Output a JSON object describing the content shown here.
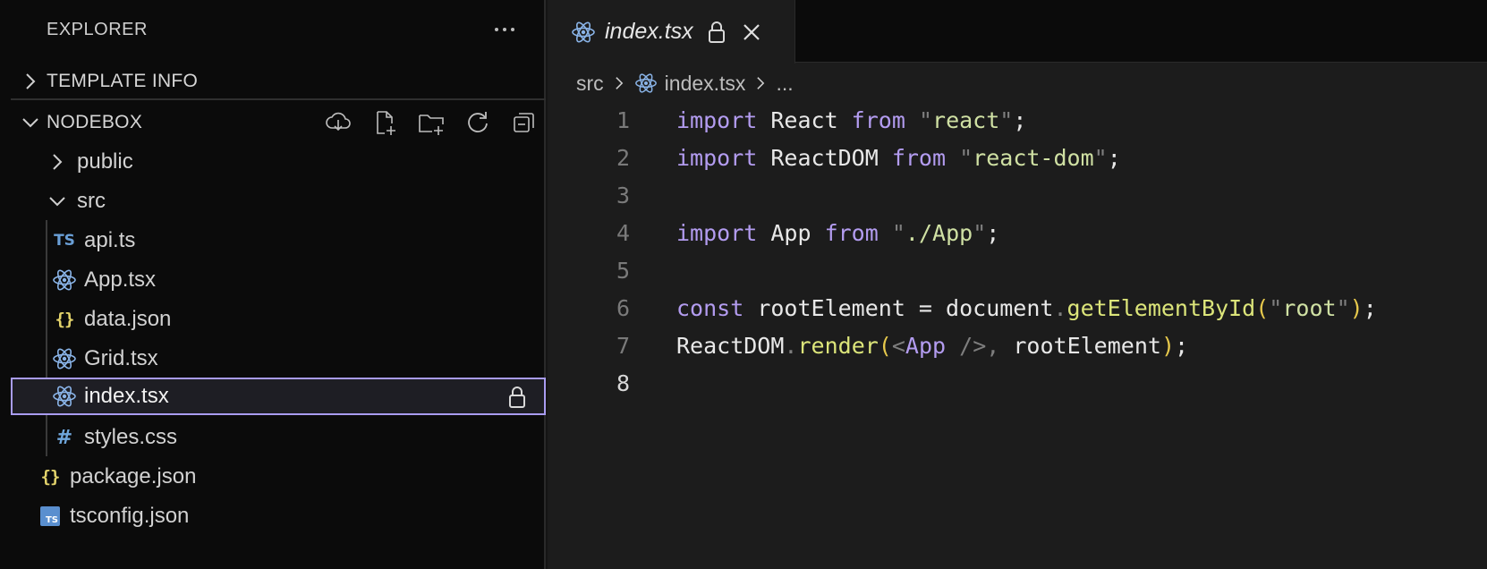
{
  "explorer": {
    "title": "EXPLORER",
    "sections": [
      {
        "label": "TEMPLATE INFO"
      },
      {
        "label": "NODEBOX"
      }
    ],
    "toolbar_icons": [
      "download-icon",
      "new-file-icon",
      "new-folder-icon",
      "refresh-icon",
      "collapse-all-icon"
    ],
    "tree": [
      {
        "label": "public",
        "type": "folder",
        "icon": "chevron-right-icon"
      },
      {
        "label": "src",
        "type": "folder",
        "icon": "chevron-down-icon"
      },
      {
        "label": "api.ts",
        "type": "file",
        "icon": "ts-icon",
        "glyph": "TS"
      },
      {
        "label": "App.tsx",
        "type": "file",
        "icon": "react-icon"
      },
      {
        "label": "data.json",
        "type": "file",
        "icon": "json-icon",
        "glyph": "{}"
      },
      {
        "label": "Grid.tsx",
        "type": "file",
        "icon": "react-icon"
      },
      {
        "label": "index.tsx",
        "type": "file",
        "icon": "react-icon",
        "selected": true,
        "locked": true
      },
      {
        "label": "styles.css",
        "type": "file",
        "icon": "css-icon",
        "glyph": "#"
      },
      {
        "label": "package.json",
        "type": "file",
        "icon": "json-icon",
        "glyph": "{}"
      },
      {
        "label": "tsconfig.json",
        "type": "file",
        "icon": "tsconfig-icon",
        "glyph": "TS"
      }
    ]
  },
  "editor": {
    "tab": {
      "label": "index.tsx"
    },
    "breadcrumb": [
      "src",
      "index.tsx",
      "..."
    ],
    "lines": [
      {
        "n": "1",
        "text": "import React from \"react\";"
      },
      {
        "n": "2",
        "text": "import ReactDOM from \"react-dom\";"
      },
      {
        "n": "3",
        "text": ""
      },
      {
        "n": "4",
        "text": "import App from \"./App\";"
      },
      {
        "n": "5",
        "text": ""
      },
      {
        "n": "6",
        "text": "const rootElement = document.getElementById(\"root\");"
      },
      {
        "n": "7",
        "text": "ReactDOM.render(<App />, rootElement);"
      },
      {
        "n": "8",
        "text": ""
      }
    ]
  },
  "colors": {
    "keyword": "#b39cf0",
    "string": "#cfe0a3",
    "function": "#dce57a",
    "selection_border": "#a99cf0",
    "react_icon": "#8ab4e8"
  }
}
